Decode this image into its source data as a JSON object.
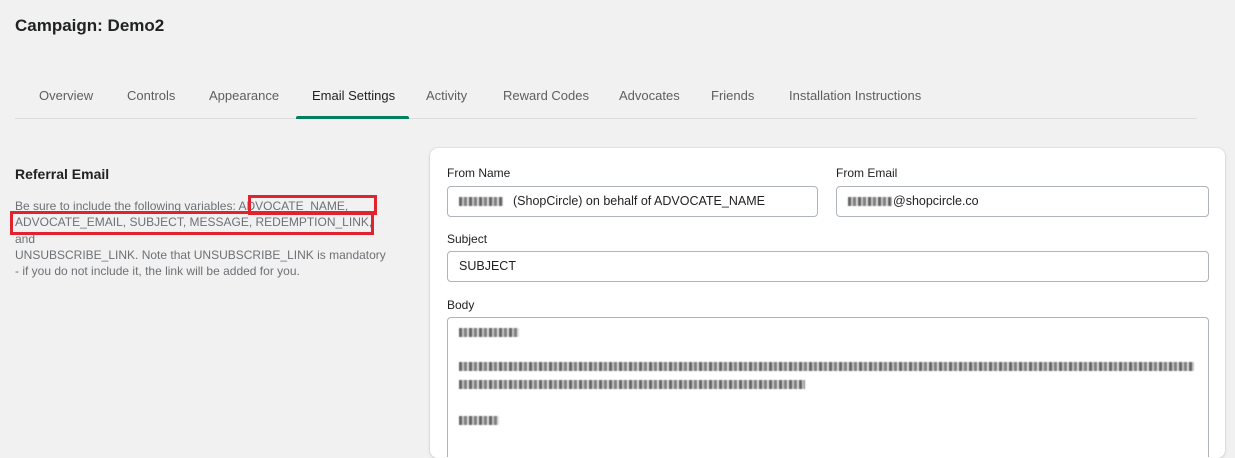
{
  "page": {
    "title": "Campaign: Demo2"
  },
  "tabs": [
    {
      "label": "Overview"
    },
    {
      "label": "Controls"
    },
    {
      "label": "Appearance"
    },
    {
      "label": "Email Settings",
      "active": true
    },
    {
      "label": "Activity"
    },
    {
      "label": "Reward Codes"
    },
    {
      "label": "Advocates"
    },
    {
      "label": "Friends"
    },
    {
      "label": "Installation Instructions"
    }
  ],
  "referral": {
    "title": "Referral Email",
    "desc_line1": "Be sure to include the following variables: ADVOCATE_NAME,",
    "desc_line2": "ADVOCATE_EMAIL, SUBJECT, MESSAGE, REDEMPTION_LINK, and",
    "desc_line3": "UNSUBSCRIBE_LINK. Note that UNSUBSCRIBE_LINK is mandatory",
    "desc_line4": "- if you do not include it, the link will be added for you."
  },
  "form": {
    "from_name_label": "From Name",
    "from_name_value": "(ShopCircle) on behalf of ADVOCATE_NAME",
    "from_email_label": "From Email",
    "from_email_value": "@shopcircle.co",
    "subject_label": "Subject",
    "subject_value": "SUBJECT",
    "body_label": "Body"
  },
  "colors": {
    "accent": "#007f5f",
    "highlight": "#e0232e",
    "background": "#f1f1f1"
  }
}
